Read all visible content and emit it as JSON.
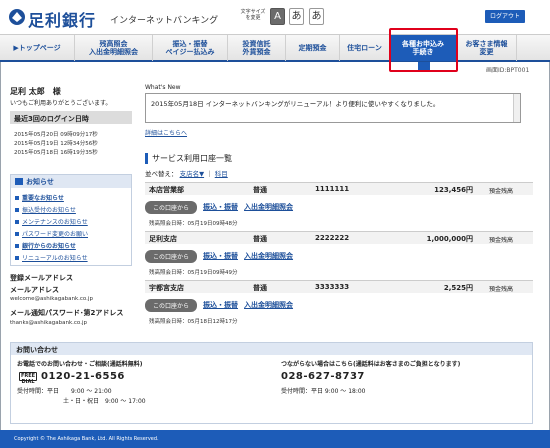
{
  "header": {
    "bank_name": "足利銀行",
    "service_name": "インターネットバンキング",
    "font_size_label": "文字サイズを変更",
    "font_sizes": [
      "A",
      "あ",
      "あ"
    ],
    "logout_label": "ログアウト"
  },
  "nav": {
    "items": [
      "▶トップページ",
      "残高照会\n入出金明細照会",
      "振込・振替\nペイジー払込み",
      "投資信託\n外貨預金",
      "定期預金",
      "住宅ローン",
      "各種お申込み\n手続き",
      "お客さま情報\n変更"
    ],
    "active_index": 6
  },
  "screen_id": "画面ID:BPT001",
  "greeting": {
    "name": "足利 太郎　様",
    "message": "いつもご利用ありがとうございます。"
  },
  "login_history": {
    "title": "最近3回のログイン日時",
    "entries": [
      "2015年05月20日 09時09分17秒",
      "2015年05月19日 12時34分56秒",
      "2015年05月18日 16時19分35秒"
    ]
  },
  "notices": {
    "title": "お知らせ",
    "items": [
      "重要なお知らせ",
      "振込受付のお知らせ",
      "メンテナンスのお知らせ",
      "パスワード変更のお願い",
      "銀行からのお知らせ",
      "リニューアルのお知らせ"
    ]
  },
  "registered_mail": {
    "title": "登録メールアドレス",
    "mail_label": "メールアドレス",
    "mail_value": "welcome@ashikagabank.co.jp",
    "notify_label": "メール通知パスワード･第2アドレス",
    "notify_value": "thanks@ashikagabank.co.jp"
  },
  "whats_new": {
    "label": "What's New",
    "text": "2015年05月18日 インターネットバンキングがリニューアル！より便利に使いやすくなりました。",
    "link": "詳細はこちらへ"
  },
  "accounts": {
    "title": "サービス利用口座一覧",
    "sort_label": "並べ替え：",
    "sort_branch": "支店名▼",
    "sort_separator": "｜",
    "sort_subject": "科目",
    "pill_label": "この口座から",
    "transfer_label": "振込・振替",
    "statement_label": "入出金明細照会",
    "balance_label": "預金残高",
    "rows": [
      {
        "branch": "本店営業部",
        "type": "普通",
        "number": "1111111",
        "balance": "123,456円",
        "updated": "残高照会日時：05月19日09時48分"
      },
      {
        "branch": "足利支店",
        "type": "普通",
        "number": "2222222",
        "balance": "1,000,000円",
        "updated": "残高照会日時：05月19日09時49分"
      },
      {
        "branch": "宇都宮支店",
        "type": "普通",
        "number": "3333333",
        "balance": "2,525円",
        "updated": "残高照会日時：05月18日12時17分"
      }
    ]
  },
  "contact": {
    "title": "お問い合わせ",
    "phone_heading": "お電話でのお問い合わせ・ご相談(通話料無料)",
    "freedial_label": "FREE DIAL",
    "phone_number": "0120-21-6556",
    "hours_weekday": "受付時間：平日　　9:00 ～ 21:00",
    "hours_weekend": "土・日・祝日　9:00 ～ 17:00",
    "alt_heading": "つながらない場合はこちら(通話料はお客さまのご負担となります)",
    "alt_number": "028-627-8737",
    "alt_hours": "受付時間：平日 9:00 ～ 18:00"
  },
  "footer": {
    "copyright": "Copyright © The Ashikaga Bank, Ltd. All Rights Reserved."
  },
  "colors": {
    "brand": "#1d4f9a",
    "accent": "#1d5cb8",
    "highlight": "#e0001b"
  }
}
